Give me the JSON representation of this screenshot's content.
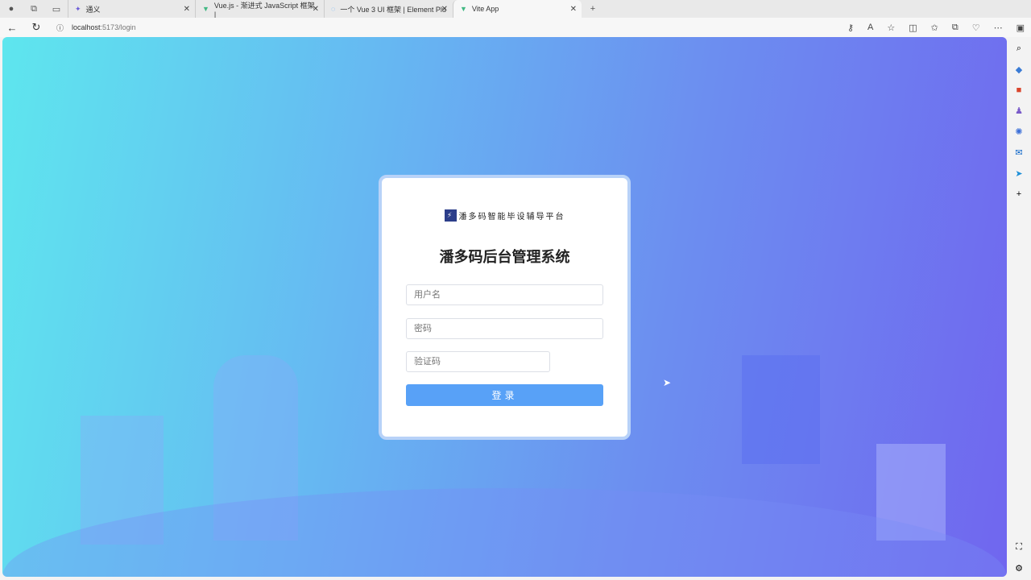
{
  "browser": {
    "tabs": [
      {
        "label": "通义"
      },
      {
        "label": "Vue.js - 渐进式 JavaScript 框架 |"
      },
      {
        "label": "一个 Vue 3 UI 框架 | Element Plu"
      },
      {
        "label": "Vite App",
        "active": true
      }
    ],
    "url_host": "localhost",
    "url_path": ":5173/login"
  },
  "login": {
    "brand": "潘多码智能毕设辅导平台",
    "title": "潘多码后台管理系统",
    "username_placeholder": "用户名",
    "password_placeholder": "密码",
    "captcha_placeholder": "验证码",
    "submit_label": "登录"
  },
  "colors": {
    "button": "#58a1f7",
    "bg_start": "#5ee6ee",
    "bg_end": "#7066ef"
  }
}
